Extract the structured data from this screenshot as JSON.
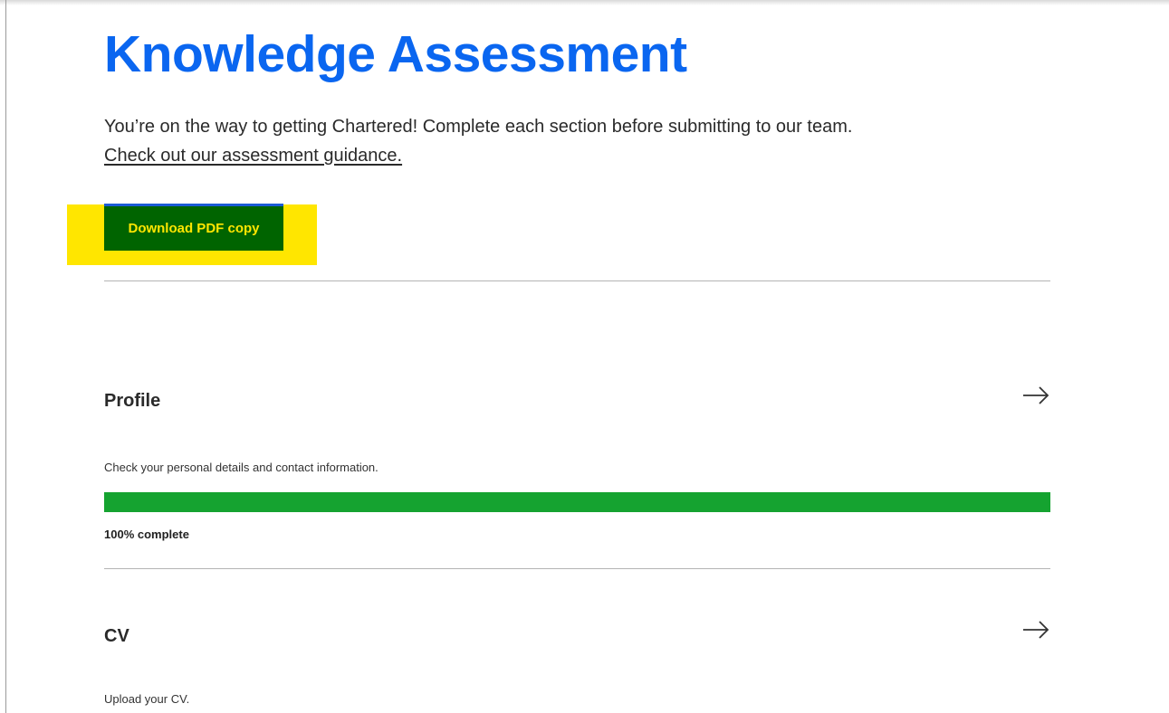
{
  "page": {
    "title": "Knowledge Assessment",
    "intro_text": "You’re on the way to getting Chartered! Complete each section before submitting to our team.",
    "guidance_link": "Check out our assessment guidance.",
    "download_label": "Download PDF copy"
  },
  "colors": {
    "title": "#0a66f0",
    "highlight": "#ffe600",
    "button_bg": "#006400",
    "button_text": "#ffe600",
    "progress_fill": "#15a330"
  },
  "sections": [
    {
      "title": "Profile",
      "description": "Check your personal details and contact information.",
      "progress_percent": 100,
      "progress_label": "100% complete",
      "icon": "arrow-right-icon"
    },
    {
      "title": "CV",
      "description": "Upload your CV.",
      "icon": "arrow-right-icon"
    }
  ]
}
